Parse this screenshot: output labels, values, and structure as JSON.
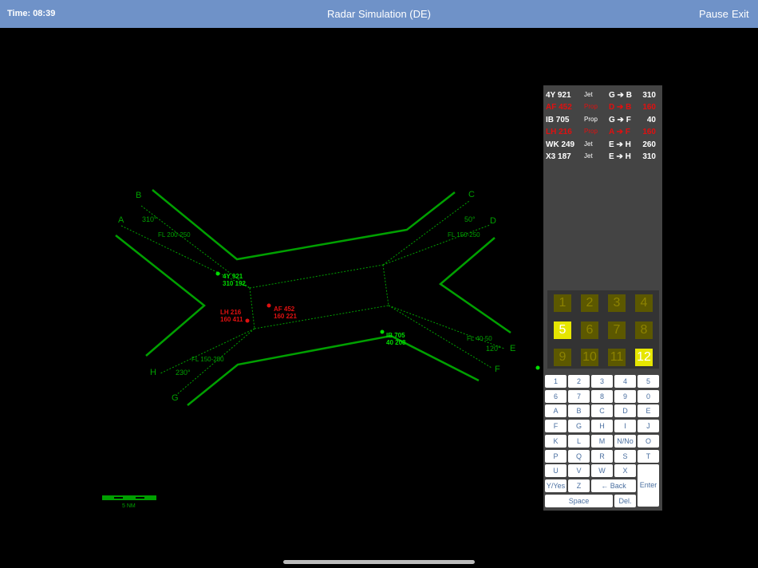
{
  "topbar": {
    "time": "Time: 08:39",
    "title": "Radar Simulation (DE)",
    "pause": "Pause",
    "exit": "Exit"
  },
  "radar": {
    "fixes": [
      "A",
      "B",
      "C",
      "D",
      "E",
      "F",
      "G",
      "H"
    ],
    "headings": {
      "a": "310°",
      "c": "50°",
      "e": "120°",
      "h": "230°"
    },
    "levels": {
      "ab": "FL 200-250",
      "cd": "FL 150-250",
      "ef": "FL 40-50",
      "gh": "FL 150-250"
    },
    "aircraft": [
      {
        "callsign": "4Y 921",
        "data": "310 192",
        "color": "#00dd00"
      },
      {
        "callsign": "AF 452",
        "data": "160  221",
        "color": "#e01010"
      },
      {
        "callsign": "LH 216",
        "data": "160  411",
        "color": "#e01010"
      },
      {
        "callsign": "IB 705",
        "data": "40   208",
        "color": "#00dd00"
      }
    ],
    "scale_label": "5 NM"
  },
  "flight_strips": [
    {
      "callsign": "4Y 921",
      "type": "Jet",
      "route": "G ➔ B",
      "level": "310",
      "status": "white"
    },
    {
      "callsign": "AF 452",
      "type": "Prop",
      "route": "D ➔ B",
      "level": "160",
      "status": "red"
    },
    {
      "callsign": "IB 705",
      "type": "Prop",
      "route": "G ➔ F",
      "level": "40",
      "status": "white"
    },
    {
      "callsign": "LH 216",
      "type": "Prop",
      "route": "A ➔ F",
      "level": "160",
      "status": "red"
    },
    {
      "callsign": "WK 249",
      "type": "Jet",
      "route": "E ➔ H",
      "level": "260",
      "status": "white"
    },
    {
      "callsign": "X3 187",
      "type": "Jet",
      "route": "E ➔ H",
      "level": "310",
      "status": "white"
    }
  ],
  "speed_grid": {
    "cells": [
      "1",
      "2",
      "3",
      "4",
      "5",
      "6",
      "7",
      "8",
      "9",
      "10",
      "11",
      "12"
    ],
    "active": [
      "5",
      "12"
    ]
  },
  "keyboard": {
    "rows": [
      [
        "1",
        "2",
        "3",
        "4",
        "5"
      ],
      [
        "6",
        "7",
        "8",
        "9",
        "0"
      ],
      [
        "A",
        "B",
        "C",
        "D",
        "E"
      ],
      [
        "F",
        "G",
        "H",
        "I",
        "J"
      ],
      [
        "K",
        "L",
        "M",
        "N/No",
        "O"
      ],
      [
        "P",
        "Q",
        "R",
        "S",
        "T"
      ],
      [
        "U",
        "V",
        "W",
        "X"
      ],
      [
        "Y/Yes",
        "Z",
        "← Back",
        "Enter"
      ],
      [
        "Space",
        "Del."
      ]
    ]
  }
}
